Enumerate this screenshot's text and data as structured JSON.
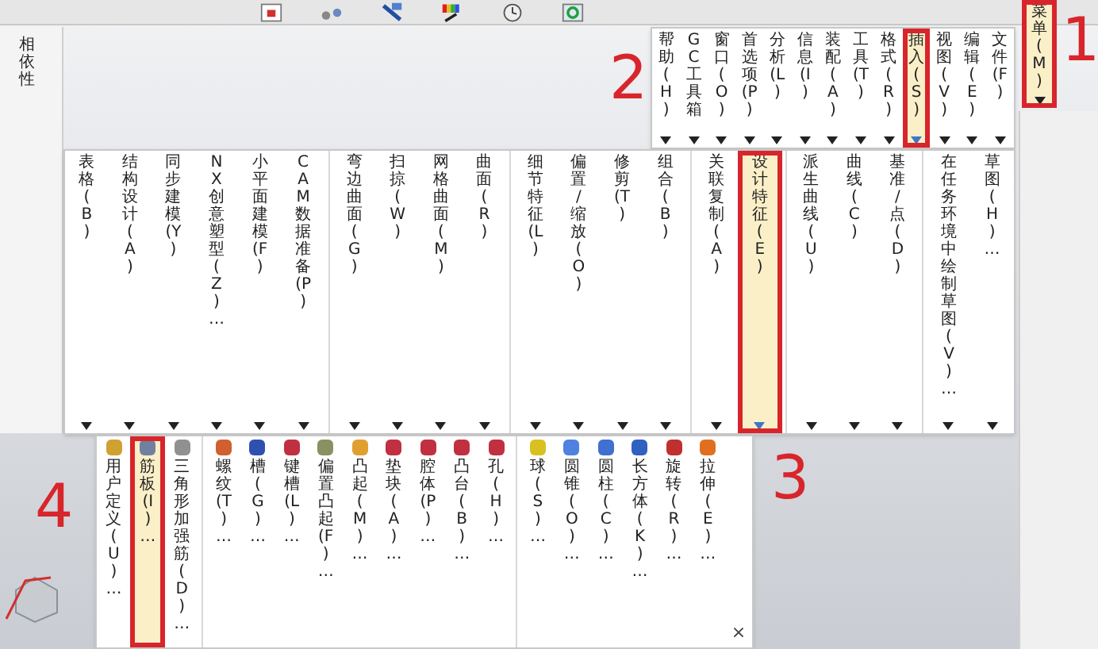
{
  "navigator_tab": "相依性",
  "menu_button": {
    "label": "菜单(M)",
    "selected": true,
    "marker": "1"
  },
  "menu_bar": [
    {
      "label": "帮助(H)",
      "selected": false
    },
    {
      "label": "GC工具箱",
      "selected": false
    },
    {
      "label": "窗口(O)",
      "selected": false
    },
    {
      "label": "首选项(P)",
      "selected": false
    },
    {
      "label": "分析(L)",
      "selected": false
    },
    {
      "label": "信息(I)",
      "selected": false
    },
    {
      "label": "装配(A)",
      "selected": false
    },
    {
      "label": "工具(T)",
      "selected": false
    },
    {
      "label": "格式(R)",
      "selected": false
    },
    {
      "label": "插入(S)",
      "selected": true,
      "marker": "2"
    },
    {
      "label": "视图(V)",
      "selected": false
    },
    {
      "label": "编辑(E)",
      "selected": false
    },
    {
      "label": "文件(F)",
      "selected": false
    }
  ],
  "insert_menu": [
    {
      "kind": "item",
      "label": "表格(B)",
      "selected": false
    },
    {
      "kind": "item",
      "label": "结构设计(A)",
      "selected": false
    },
    {
      "kind": "item",
      "label": "同步建模(Y)",
      "selected": false
    },
    {
      "kind": "item",
      "label": "NX 创意塑型(Z)…",
      "selected": false
    },
    {
      "kind": "item",
      "label": "小平面建模(F)",
      "selected": false
    },
    {
      "kind": "item",
      "label": "CAM 数据准备(P)",
      "selected": false
    },
    {
      "kind": "separator"
    },
    {
      "kind": "item",
      "label": "弯边曲面(G)",
      "selected": false
    },
    {
      "kind": "item",
      "label": "扫掠(W)",
      "selected": false
    },
    {
      "kind": "item",
      "label": "网格曲面(M)",
      "selected": false
    },
    {
      "kind": "item",
      "label": "曲面(R)",
      "selected": false
    },
    {
      "kind": "separator"
    },
    {
      "kind": "item",
      "label": "细节特征(L)",
      "selected": false
    },
    {
      "kind": "item",
      "label": "偏置/缩放(O)",
      "selected": false
    },
    {
      "kind": "item",
      "label": "修剪(T)",
      "selected": false
    },
    {
      "kind": "item",
      "label": "组合(B)",
      "selected": false
    },
    {
      "kind": "separator"
    },
    {
      "kind": "item",
      "label": "关联复制(A)",
      "selected": false
    },
    {
      "kind": "item",
      "label": "设计特征(E)",
      "selected": true,
      "marker": "3"
    },
    {
      "kind": "separator"
    },
    {
      "kind": "item",
      "label": "派生曲线(U)",
      "selected": false
    },
    {
      "kind": "item",
      "label": "曲线(C)",
      "selected": false
    },
    {
      "kind": "item",
      "label": "基准/点(D)",
      "selected": false
    },
    {
      "kind": "separator"
    },
    {
      "kind": "item",
      "label": "在任务环境中绘制草图(V)…",
      "selected": false
    },
    {
      "kind": "item",
      "label": "草图(H)…",
      "selected": false
    }
  ],
  "design_feature_menu": {
    "items": [
      {
        "kind": "item",
        "label": "用户定义(U)…",
        "selected": false,
        "color": "#d0a030"
      },
      {
        "kind": "item",
        "label": "筋板(I)…",
        "selected": true,
        "marker": "4",
        "color": "#7080a0"
      },
      {
        "kind": "item",
        "label": "三角形加强筋(D)…",
        "selected": false,
        "color": "#909090"
      },
      {
        "kind": "separator"
      },
      {
        "kind": "item",
        "label": "螺纹(T)…",
        "selected": false,
        "color": "#d06030"
      },
      {
        "kind": "item",
        "label": "槽(G)…",
        "selected": false,
        "color": "#3050b0"
      },
      {
        "kind": "item",
        "label": "键槽(L)…",
        "selected": false,
        "color": "#c03040"
      },
      {
        "kind": "item",
        "label": "偏置凸起(F)…",
        "selected": false,
        "color": "#8a9060"
      },
      {
        "kind": "item",
        "label": "凸起(M)…",
        "selected": false,
        "color": "#e0a030"
      },
      {
        "kind": "item",
        "label": "垫块(A)…",
        "selected": false,
        "color": "#c03040"
      },
      {
        "kind": "item",
        "label": "腔体(P)…",
        "selected": false,
        "color": "#c03040"
      },
      {
        "kind": "item",
        "label": "凸台(B)…",
        "selected": false,
        "color": "#c03040"
      },
      {
        "kind": "item",
        "label": "孔(H)…",
        "selected": false,
        "color": "#c03040"
      },
      {
        "kind": "separator"
      },
      {
        "kind": "item",
        "label": "球(S)…",
        "selected": false,
        "color": "#d8c020"
      },
      {
        "kind": "item",
        "label": "圆锥(O)…",
        "selected": false,
        "color": "#5080e0"
      },
      {
        "kind": "item",
        "label": "圆柱(C)…",
        "selected": false,
        "color": "#4070d0"
      },
      {
        "kind": "item",
        "label": "长方体(K)…",
        "selected": false,
        "color": "#3060c0"
      },
      {
        "kind": "item",
        "label": "旋转(R)…",
        "selected": false,
        "color": "#c03030"
      },
      {
        "kind": "item",
        "label": "拉伸(E)…",
        "selected": false,
        "color": "#e07020"
      }
    ],
    "close": "×"
  }
}
